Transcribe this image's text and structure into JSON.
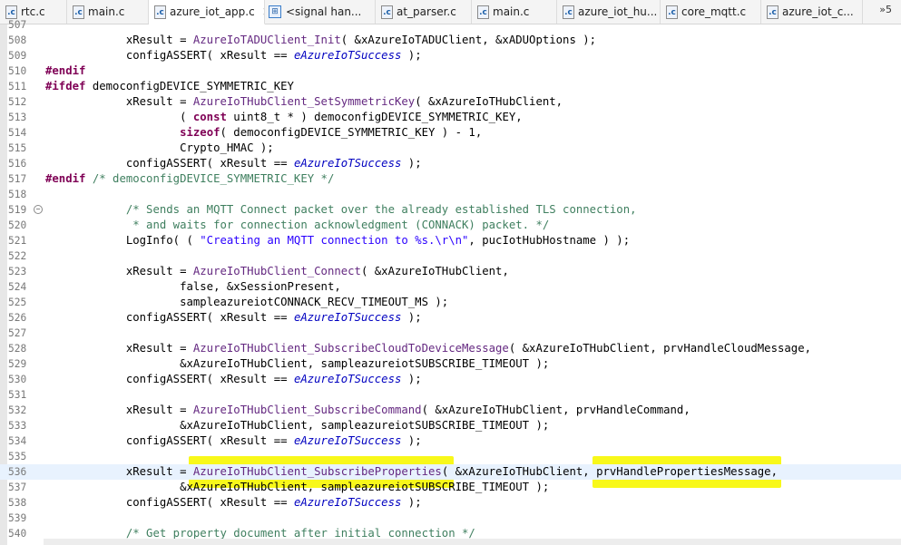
{
  "tabs": [
    {
      "label": "rtc.c",
      "icon": "c-file-icon",
      "active": false
    },
    {
      "label": "main.c",
      "icon": "c-file-icon",
      "active": false
    },
    {
      "label": "azure_iot_app.c",
      "icon": "c-file-icon",
      "active": true
    },
    {
      "label": "<signal han...",
      "icon": "signal-handler-icon",
      "active": false
    },
    {
      "label": "at_parser.c",
      "icon": "c-file-icon",
      "active": false
    },
    {
      "label": "main.c",
      "icon": "c-file-icon",
      "active": false
    },
    {
      "label": "azure_iot_hu...",
      "icon": "c-file-icon",
      "active": false
    },
    {
      "label": "core_mqtt.c",
      "icon": "c-file-icon",
      "active": false
    },
    {
      "label": "azure_iot_c...",
      "icon": "c-file-icon",
      "active": false
    }
  ],
  "tab_overflow": "»5",
  "close_glyph": "×",
  "file_icon_glyph": ".c",
  "lines": [
    {
      "num": "507",
      "tokens": []
    },
    {
      "num": "508",
      "tokens": [
        [
          "t",
          "            xResult = "
        ],
        [
          "fn",
          "AzureIoTADUClient_Init"
        ],
        [
          "t",
          "( &xAzureIoTADUClient, &xADUOptions );"
        ]
      ]
    },
    {
      "num": "509",
      "tokens": [
        [
          "t",
          "            configASSERT( xResult == "
        ],
        [
          "en",
          "eAzureIoTSuccess"
        ],
        [
          "t",
          " );"
        ]
      ]
    },
    {
      "num": "510",
      "tokens": [
        [
          "kw",
          "#endif"
        ]
      ]
    },
    {
      "num": "511",
      "tokens": [
        [
          "kw",
          "#ifdef"
        ],
        [
          "t",
          " democonfigDEVICE_SYMMETRIC_KEY"
        ]
      ]
    },
    {
      "num": "512",
      "tokens": [
        [
          "t",
          "            xResult = "
        ],
        [
          "fn",
          "AzureIoTHubClient_SetSymmetricKey"
        ],
        [
          "t",
          "( &xAzureIoTHubClient,"
        ]
      ]
    },
    {
      "num": "513",
      "tokens": [
        [
          "t",
          "                    ( "
        ],
        [
          "kw",
          "const"
        ],
        [
          "t",
          " uint8_t * ) democonfigDEVICE_SYMMETRIC_KEY,"
        ]
      ]
    },
    {
      "num": "514",
      "tokens": [
        [
          "t",
          "                    "
        ],
        [
          "kw",
          "sizeof"
        ],
        [
          "t",
          "( democonfigDEVICE_SYMMETRIC_KEY ) - 1,"
        ]
      ]
    },
    {
      "num": "515",
      "tokens": [
        [
          "t",
          "                    Crypto_HMAC );"
        ]
      ]
    },
    {
      "num": "516",
      "tokens": [
        [
          "t",
          "            configASSERT( xResult == "
        ],
        [
          "en",
          "eAzureIoTSuccess"
        ],
        [
          "t",
          " );"
        ]
      ]
    },
    {
      "num": "517",
      "tokens": [
        [
          "kw",
          "#endif"
        ],
        [
          "cm",
          " /* democonfigDEVICE_SYMMETRIC_KEY */"
        ]
      ]
    },
    {
      "num": "518",
      "tokens": []
    },
    {
      "num": "519",
      "fold": true,
      "tokens": [
        [
          "cm",
          "            /* Sends an MQTT Connect packet over the already established TLS connection,"
        ]
      ]
    },
    {
      "num": "520",
      "tokens": [
        [
          "cm",
          "             * and waits for connection acknowledgment (CONNACK) packet. */"
        ]
      ]
    },
    {
      "num": "521",
      "tokens": [
        [
          "t",
          "            LogInfo( ( "
        ],
        [
          "st",
          "\"Creating an MQTT connection to %s.\\r\\n\""
        ],
        [
          "t",
          ", pucIotHubHostname ) );"
        ]
      ]
    },
    {
      "num": "522",
      "tokens": []
    },
    {
      "num": "523",
      "tokens": [
        [
          "t",
          "            xResult = "
        ],
        [
          "fn",
          "AzureIoTHubClient_Connect"
        ],
        [
          "t",
          "( &xAzureIoTHubClient,"
        ]
      ]
    },
    {
      "num": "524",
      "tokens": [
        [
          "t",
          "                    false, &xSessionPresent,"
        ]
      ]
    },
    {
      "num": "525",
      "tokens": [
        [
          "t",
          "                    sampleazureiotCONNACK_RECV_TIMEOUT_MS );"
        ]
      ]
    },
    {
      "num": "526",
      "tokens": [
        [
          "t",
          "            configASSERT( xResult == "
        ],
        [
          "en",
          "eAzureIoTSuccess"
        ],
        [
          "t",
          " );"
        ]
      ]
    },
    {
      "num": "527",
      "tokens": []
    },
    {
      "num": "528",
      "tokens": [
        [
          "t",
          "            xResult = "
        ],
        [
          "fn",
          "AzureIoTHubClient_SubscribeCloudToDeviceMessage"
        ],
        [
          "t",
          "( &xAzureIoTHubClient, prvHandleCloudMessage,"
        ]
      ]
    },
    {
      "num": "529",
      "tokens": [
        [
          "t",
          "                    &xAzureIoTHubClient, sampleazureiotSUBSCRIBE_TIMEOUT );"
        ]
      ]
    },
    {
      "num": "530",
      "tokens": [
        [
          "t",
          "            configASSERT( xResult == "
        ],
        [
          "en",
          "eAzureIoTSuccess"
        ],
        [
          "t",
          " );"
        ]
      ]
    },
    {
      "num": "531",
      "tokens": []
    },
    {
      "num": "532",
      "tokens": [
        [
          "t",
          "            xResult = "
        ],
        [
          "fn",
          "AzureIoTHubClient_SubscribeCommand"
        ],
        [
          "t",
          "( &xAzureIoTHubClient, prvHandleCommand,"
        ]
      ]
    },
    {
      "num": "533",
      "tokens": [
        [
          "t",
          "                    &xAzureIoTHubClient, sampleazureiotSUBSCRIBE_TIMEOUT );"
        ]
      ]
    },
    {
      "num": "534",
      "tokens": [
        [
          "t",
          "            configASSERT( xResult == "
        ],
        [
          "en",
          "eAzureIoTSuccess"
        ],
        [
          "t",
          " );"
        ]
      ]
    },
    {
      "num": "535",
      "tokens": []
    },
    {
      "num": "536",
      "current": true,
      "tokens": [
        [
          "t",
          "            xResult = "
        ],
        [
          "fn",
          "AzureIoTHubClient_SubscribeProperties"
        ],
        [
          "t",
          "( &xAzureIoTHubClient, prvHandlePropertiesMessage,"
        ]
      ]
    },
    {
      "num": "537",
      "tokens": [
        [
          "t",
          "                    &xAzureIoTHubClient, sampleazureiotSUBSCRIBE_TIMEOUT );"
        ]
      ]
    },
    {
      "num": "538",
      "tokens": [
        [
          "t",
          "            configASSERT( xResult == "
        ],
        [
          "en",
          "eAzureIoTSuccess"
        ],
        [
          "t",
          " );"
        ]
      ]
    },
    {
      "num": "539",
      "tokens": []
    },
    {
      "num": "540",
      "tokens": [
        [
          "cm",
          "            /* Get property document after initial connection */"
        ]
      ]
    }
  ],
  "colors": {
    "keyword": "#7f0055",
    "function": "#642880",
    "comment": "#3f7f5f",
    "string": "#2a00ff",
    "enum": "#0000c0",
    "current_line": "#e8f2fe",
    "highlighter": "#f7f707"
  }
}
